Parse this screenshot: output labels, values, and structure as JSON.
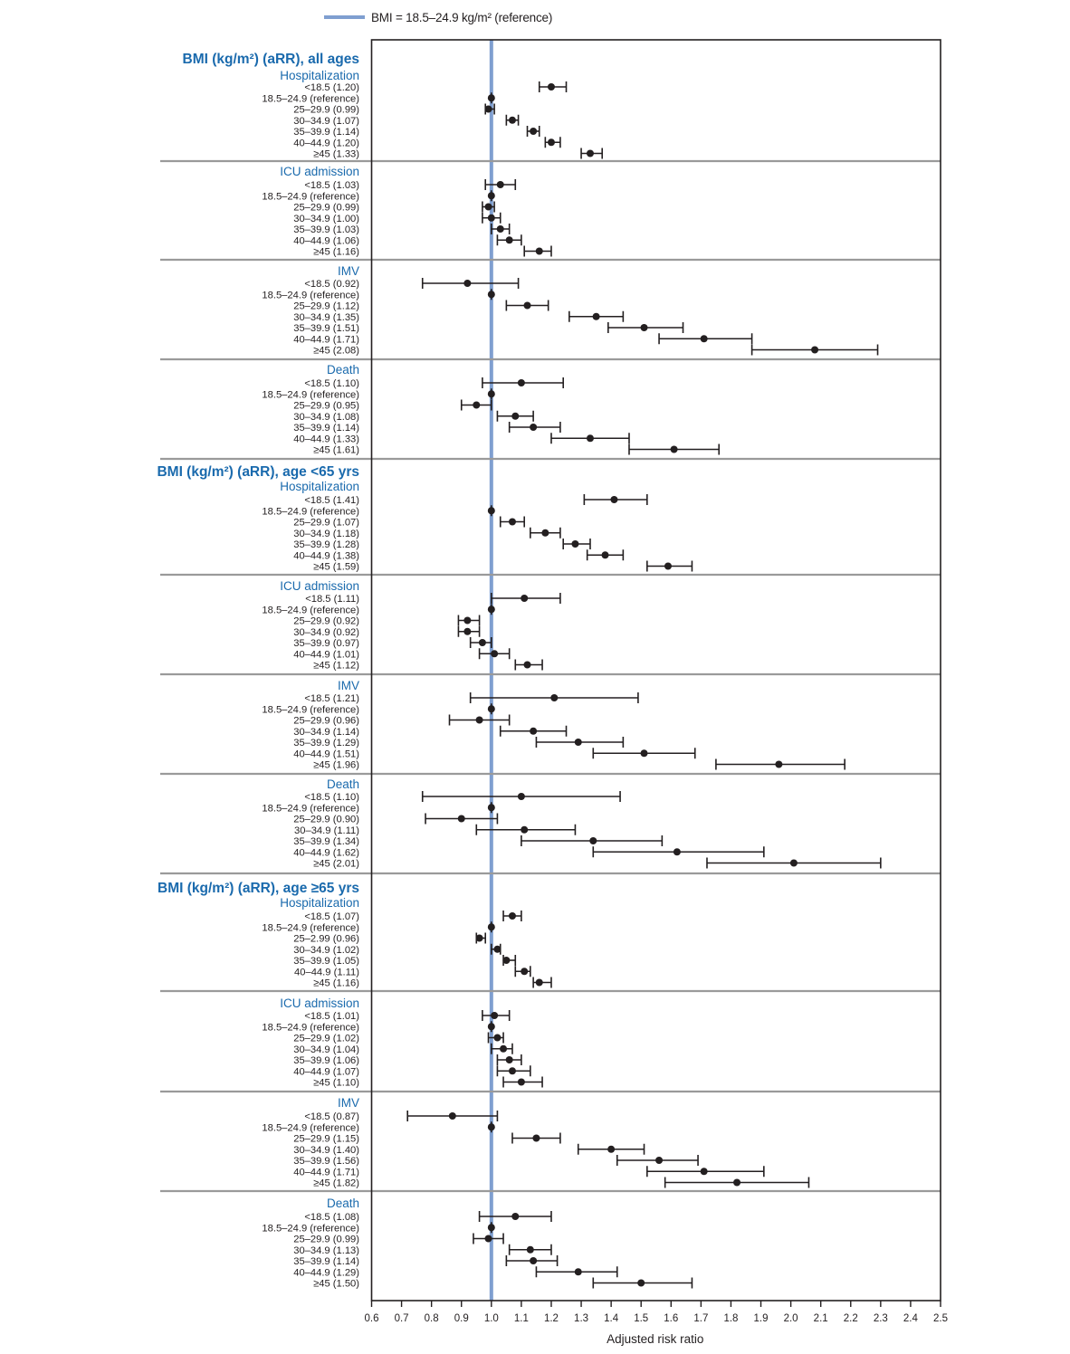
{
  "legend": {
    "label": "BMI = 18.5–24.9 kg/m² (reference)",
    "color": "#7f9fd0"
  },
  "chart_data": {
    "type": "forest",
    "title": "",
    "xlabel": "Adjusted risk ratio",
    "xlim": [
      0.6,
      2.5
    ],
    "xticks": [
      "0.6",
      "0.7",
      "0.8",
      "0.9",
      "1.0",
      "1.1",
      "1.2",
      "1.3",
      "1.4",
      "1.5",
      "1.6",
      "1.7",
      "1.8",
      "1.9",
      "2.0",
      "2.1",
      "2.2",
      "2.3",
      "2.4",
      "2.5"
    ],
    "reference_value": 1.0,
    "grid": false,
    "legend_position": "top-center",
    "colors": {
      "heading": "#1a6aad",
      "reference_line": "#7f9fd0",
      "divider": "#9a9a9a",
      "marker": "#231f20"
    },
    "sections": [
      {
        "title": "BMI (kg/m²) (aRR), all ages",
        "panels": [
          {
            "outcome": "Hospitalization",
            "rows": [
              {
                "label": "<18.5 (1.20)",
                "est": 1.2,
                "lo": 1.16,
                "hi": 1.25
              },
              {
                "label": "18.5–24.9 (reference)",
                "est": 1.0,
                "lo": null,
                "hi": null
              },
              {
                "label": "25–29.9 (0.99)",
                "est": 0.99,
                "lo": 0.98,
                "hi": 1.01
              },
              {
                "label": "30–34.9 (1.07)",
                "est": 1.07,
                "lo": 1.05,
                "hi": 1.09
              },
              {
                "label": "35–39.9 (1.14)",
                "est": 1.14,
                "lo": 1.12,
                "hi": 1.16
              },
              {
                "label": "40–44.9 (1.20)",
                "est": 1.2,
                "lo": 1.18,
                "hi": 1.23
              },
              {
                "label": "≥45 (1.33)",
                "est": 1.33,
                "lo": 1.3,
                "hi": 1.37
              }
            ]
          },
          {
            "outcome": "ICU admission",
            "rows": [
              {
                "label": "<18.5 (1.03)",
                "est": 1.03,
                "lo": 0.98,
                "hi": 1.08
              },
              {
                "label": "18.5–24.9 (reference)",
                "est": 1.0,
                "lo": null,
                "hi": null
              },
              {
                "label": "25–29.9 (0.99)",
                "est": 0.99,
                "lo": 0.97,
                "hi": 1.01
              },
              {
                "label": "30–34.9 (1.00)",
                "est": 1.0,
                "lo": 0.97,
                "hi": 1.03
              },
              {
                "label": "35–39.9 (1.03)",
                "est": 1.03,
                "lo": 1.0,
                "hi": 1.06
              },
              {
                "label": "40–44.9 (1.06)",
                "est": 1.06,
                "lo": 1.02,
                "hi": 1.1
              },
              {
                "label": "≥45 (1.16)",
                "est": 1.16,
                "lo": 1.11,
                "hi": 1.2
              }
            ]
          },
          {
            "outcome": "IMV",
            "rows": [
              {
                "label": "<18.5 (0.92)",
                "est": 0.92,
                "lo": 0.77,
                "hi": 1.09
              },
              {
                "label": "18.5–24.9 (reference)",
                "est": 1.0,
                "lo": null,
                "hi": null
              },
              {
                "label": "25–29.9 (1.12)",
                "est": 1.12,
                "lo": 1.05,
                "hi": 1.19
              },
              {
                "label": "30–34.9 (1.35)",
                "est": 1.35,
                "lo": 1.26,
                "hi": 1.44
              },
              {
                "label": "35–39.9 (1.51)",
                "est": 1.51,
                "lo": 1.39,
                "hi": 1.64
              },
              {
                "label": "40–44.9 (1.71)",
                "est": 1.71,
                "lo": 1.56,
                "hi": 1.87
              },
              {
                "label": "≥45 (2.08)",
                "est": 2.08,
                "lo": 1.87,
                "hi": 2.29
              }
            ]
          },
          {
            "outcome": "Death",
            "rows": [
              {
                "label": "<18.5 (1.10)",
                "est": 1.1,
                "lo": 0.97,
                "hi": 1.24
              },
              {
                "label": "18.5–24.9 (reference)",
                "est": 1.0,
                "lo": null,
                "hi": null
              },
              {
                "label": "25–29.9 (0.95)",
                "est": 0.95,
                "lo": 0.9,
                "hi": 1.0
              },
              {
                "label": "30–34.9 (1.08)",
                "est": 1.08,
                "lo": 1.02,
                "hi": 1.14
              },
              {
                "label": "35–39.9 (1.14)",
                "est": 1.14,
                "lo": 1.06,
                "hi": 1.23
              },
              {
                "label": "40–44.9 (1.33)",
                "est": 1.33,
                "lo": 1.2,
                "hi": 1.46
              },
              {
                "label": "≥45 (1.61)",
                "est": 1.61,
                "lo": 1.46,
                "hi": 1.76
              }
            ]
          }
        ]
      },
      {
        "title": "BMI (kg/m²) (aRR), age <65 yrs",
        "panels": [
          {
            "outcome": "Hospitalization",
            "rows": [
              {
                "label": "<18.5 (1.41)",
                "est": 1.41,
                "lo": 1.31,
                "hi": 1.52
              },
              {
                "label": "18.5–24.9 (reference)",
                "est": 1.0,
                "lo": null,
                "hi": null
              },
              {
                "label": "25–29.9 (1.07)",
                "est": 1.07,
                "lo": 1.03,
                "hi": 1.11
              },
              {
                "label": "30–34.9 (1.18)",
                "est": 1.18,
                "lo": 1.13,
                "hi": 1.23
              },
              {
                "label": "35–39.9 (1.28)",
                "est": 1.28,
                "lo": 1.24,
                "hi": 1.33
              },
              {
                "label": "40–44.9 (1.38)",
                "est": 1.38,
                "lo": 1.32,
                "hi": 1.44
              },
              {
                "label": "≥45 (1.59)",
                "est": 1.59,
                "lo": 1.52,
                "hi": 1.67
              }
            ]
          },
          {
            "outcome": "ICU admission",
            "rows": [
              {
                "label": "<18.5 (1.11)",
                "est": 1.11,
                "lo": 1.0,
                "hi": 1.23
              },
              {
                "label": "18.5–24.9 (reference)",
                "est": 1.0,
                "lo": null,
                "hi": null
              },
              {
                "label": "25–29.9 (0.92)",
                "est": 0.92,
                "lo": 0.89,
                "hi": 0.96
              },
              {
                "label": "30–34.9 (0.92)",
                "est": 0.92,
                "lo": 0.89,
                "hi": 0.96
              },
              {
                "label": "35–39.9 (0.97)",
                "est": 0.97,
                "lo": 0.93,
                "hi": 1.0
              },
              {
                "label": "40–44.9 (1.01)",
                "est": 1.01,
                "lo": 0.96,
                "hi": 1.06
              },
              {
                "label": "≥45 (1.12)",
                "est": 1.12,
                "lo": 1.08,
                "hi": 1.17
              }
            ]
          },
          {
            "outcome": "IMV",
            "rows": [
              {
                "label": "<18.5 (1.21)",
                "est": 1.21,
                "lo": 0.93,
                "hi": 1.49
              },
              {
                "label": "18.5–24.9 (reference)",
                "est": 1.0,
                "lo": null,
                "hi": null
              },
              {
                "label": "25–29.9 (0.96)",
                "est": 0.96,
                "lo": 0.86,
                "hi": 1.06
              },
              {
                "label": "30–34.9 (1.14)",
                "est": 1.14,
                "lo": 1.03,
                "hi": 1.25
              },
              {
                "label": "35–39.9 (1.29)",
                "est": 1.29,
                "lo": 1.15,
                "hi": 1.44
              },
              {
                "label": "40–44.9 (1.51)",
                "est": 1.51,
                "lo": 1.34,
                "hi": 1.68
              },
              {
                "label": "≥45 (1.96)",
                "est": 1.96,
                "lo": 1.75,
                "hi": 2.18
              }
            ]
          },
          {
            "outcome": "Death",
            "rows": [
              {
                "label": "<18.5 (1.10)",
                "est": 1.1,
                "lo": 0.77,
                "hi": 1.43
              },
              {
                "label": "18.5–24.9 (reference)",
                "est": 1.0,
                "lo": null,
                "hi": null
              },
              {
                "label": "25–29.9 (0.90)",
                "est": 0.9,
                "lo": 0.78,
                "hi": 1.02
              },
              {
                "label": "30–34.9 (1.11)",
                "est": 1.11,
                "lo": 0.95,
                "hi": 1.28
              },
              {
                "label": "35–39.9 (1.34)",
                "est": 1.34,
                "lo": 1.1,
                "hi": 1.57
              },
              {
                "label": "40–44.9 (1.62)",
                "est": 1.62,
                "lo": 1.34,
                "hi": 1.91
              },
              {
                "label": "≥45 (2.01)",
                "est": 2.01,
                "lo": 1.72,
                "hi": 2.3
              }
            ]
          }
        ]
      },
      {
        "title": "BMI (kg/m²) (aRR), age ≥65 yrs",
        "panels": [
          {
            "outcome": "Hospitalization",
            "rows": [
              {
                "label": "<18.5 (1.07)",
                "est": 1.07,
                "lo": 1.04,
                "hi": 1.1
              },
              {
                "label": "18.5–24.9 (reference)",
                "est": 1.0,
                "lo": null,
                "hi": null
              },
              {
                "label": "25–2.99 (0.96)",
                "est": 0.96,
                "lo": 0.95,
                "hi": 0.98
              },
              {
                "label": "30–34.9 (1.02)",
                "est": 1.02,
                "lo": 1.0,
                "hi": 1.03
              },
              {
                "label": "35–39.9 (1.05)",
                "est": 1.05,
                "lo": 1.04,
                "hi": 1.08
              },
              {
                "label": "40–44.9 (1.11)",
                "est": 1.11,
                "lo": 1.08,
                "hi": 1.13
              },
              {
                "label": "≥45 (1.16)",
                "est": 1.16,
                "lo": 1.14,
                "hi": 1.2
              }
            ]
          },
          {
            "outcome": "ICU admission",
            "rows": [
              {
                "label": "<18.5 (1.01)",
                "est": 1.01,
                "lo": 0.97,
                "hi": 1.06
              },
              {
                "label": "18.5–24.9 (reference)",
                "est": 1.0,
                "lo": null,
                "hi": null
              },
              {
                "label": "25–29.9 (1.02)",
                "est": 1.02,
                "lo": 0.99,
                "hi": 1.04
              },
              {
                "label": "30–34.9 (1.04)",
                "est": 1.04,
                "lo": 1.0,
                "hi": 1.07
              },
              {
                "label": "35–39.9 (1.06)",
                "est": 1.06,
                "lo": 1.02,
                "hi": 1.1
              },
              {
                "label": "40–44.9 (1.07)",
                "est": 1.07,
                "lo": 1.02,
                "hi": 1.13
              },
              {
                "label": "≥45 (1.10)",
                "est": 1.1,
                "lo": 1.04,
                "hi": 1.17
              }
            ]
          },
          {
            "outcome": "IMV",
            "rows": [
              {
                "label": "<18.5 (0.87)",
                "est": 0.87,
                "lo": 0.72,
                "hi": 1.02
              },
              {
                "label": "18.5–24.9 (reference)",
                "est": 1.0,
                "lo": null,
                "hi": null
              },
              {
                "label": "25–29.9 (1.15)",
                "est": 1.15,
                "lo": 1.07,
                "hi": 1.23
              },
              {
                "label": "30–34.9 (1.40)",
                "est": 1.4,
                "lo": 1.29,
                "hi": 1.51
              },
              {
                "label": "35–39.9 (1.56)",
                "est": 1.56,
                "lo": 1.42,
                "hi": 1.69
              },
              {
                "label": "40–44.9 (1.71)",
                "est": 1.71,
                "lo": 1.52,
                "hi": 1.91
              },
              {
                "label": "≥45 (1.82)",
                "est": 1.82,
                "lo": 1.58,
                "hi": 2.06
              }
            ]
          },
          {
            "outcome": "Death",
            "rows": [
              {
                "label": "<18.5 (1.08)",
                "est": 1.08,
                "lo": 0.96,
                "hi": 1.2
              },
              {
                "label": "18.5–24.9 (reference)",
                "est": 1.0,
                "lo": null,
                "hi": null
              },
              {
                "label": "25–29.9 (0.99)",
                "est": 0.99,
                "lo": 0.94,
                "hi": 1.04
              },
              {
                "label": "30–34.9 (1.13)",
                "est": 1.13,
                "lo": 1.06,
                "hi": 1.2
              },
              {
                "label": "35–39.9 (1.14)",
                "est": 1.14,
                "lo": 1.05,
                "hi": 1.22
              },
              {
                "label": "40–44.9 (1.29)",
                "est": 1.29,
                "lo": 1.15,
                "hi": 1.42
              },
              {
                "label": "≥45 (1.50)",
                "est": 1.5,
                "lo": 1.34,
                "hi": 1.67
              }
            ]
          }
        ]
      }
    ]
  }
}
